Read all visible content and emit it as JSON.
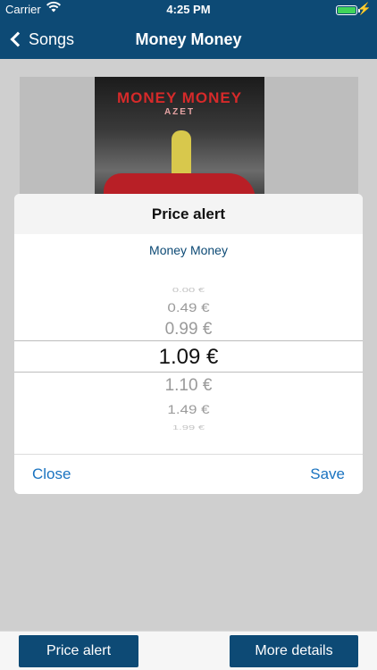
{
  "status_bar": {
    "carrier": "Carrier",
    "time": "4:25 PM",
    "wifi_icon": "wifi-icon",
    "battery_icon": "battery-icon",
    "charging_icon": "bolt-icon"
  },
  "nav": {
    "back_label": "Songs",
    "title": "Money Money"
  },
  "cover": {
    "title_text": "MONEY MONEY",
    "artist_text": "AZET"
  },
  "modal": {
    "title": "Price alert",
    "song": "Money Money",
    "picker_values": [
      "0.00 €",
      "0.49 €",
      "0.99 €",
      "1.09 €",
      "1.10 €",
      "1.49 €",
      "1.99 €"
    ],
    "selected_value": "1.09 €",
    "close_label": "Close",
    "save_label": "Save"
  },
  "bottom": {
    "price_alert_label": "Price alert",
    "more_details_label": "More details"
  },
  "colors": {
    "nav_bg": "#0d4a75",
    "link": "#1a73c0",
    "content_bg": "#cfcfcf"
  }
}
